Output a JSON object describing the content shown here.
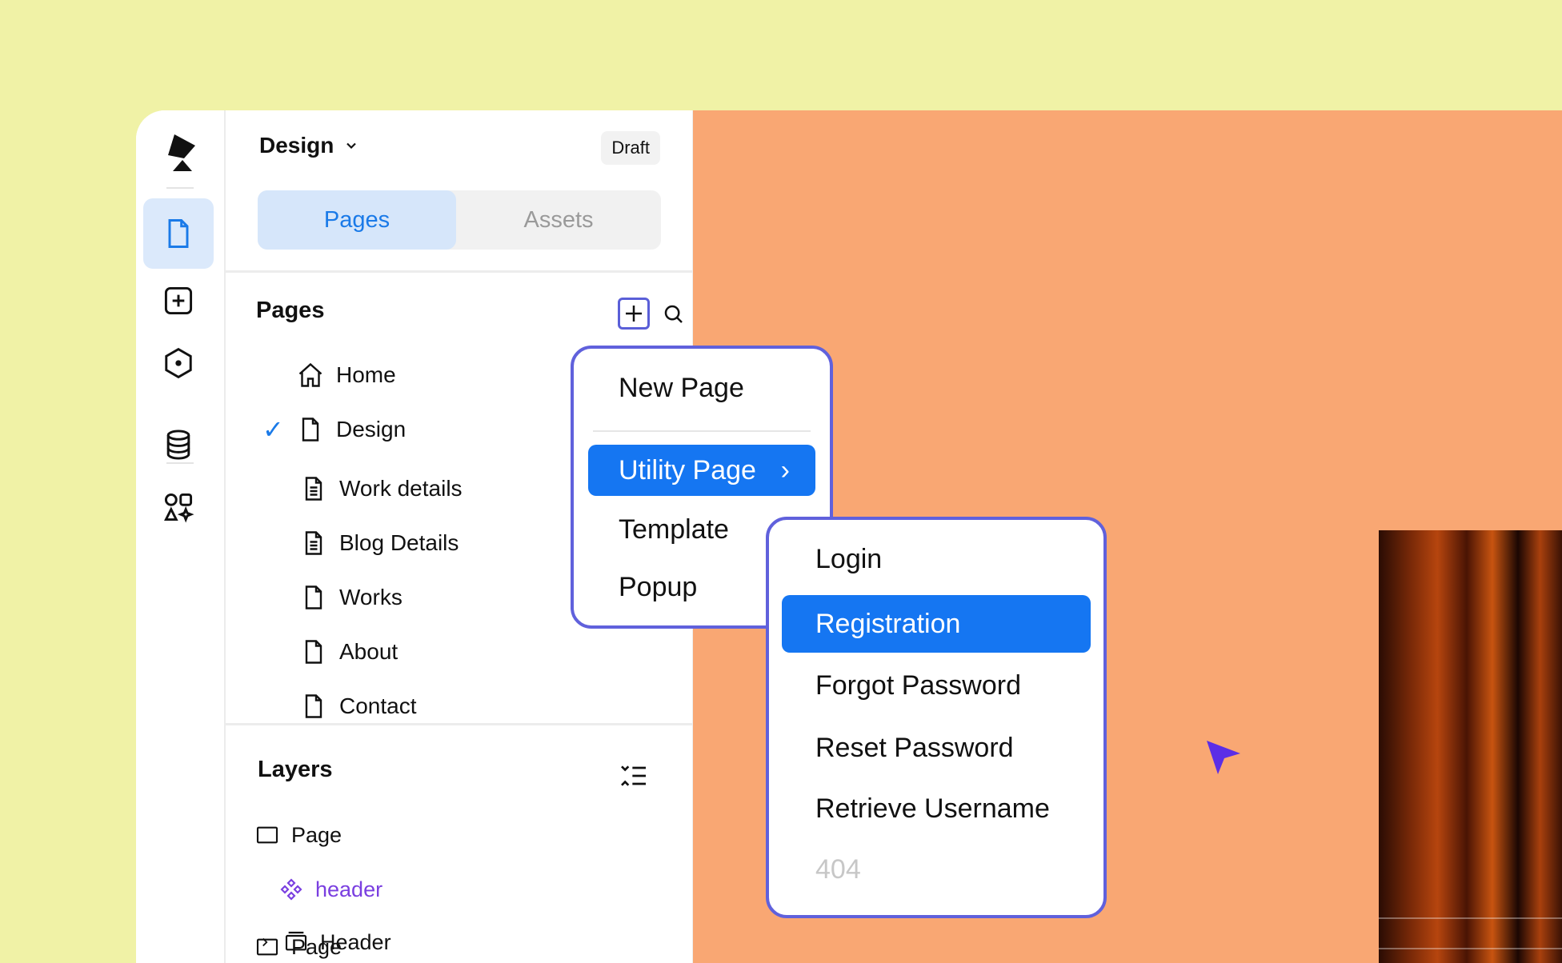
{
  "rail": {
    "icons": [
      "logo-icon",
      "page-icon",
      "add-icon",
      "component-icon",
      "database-icon",
      "apps-icon"
    ]
  },
  "panel": {
    "title": "Design",
    "status": "Draft",
    "tabs": [
      {
        "label": "Pages",
        "active": true
      },
      {
        "label": "Assets",
        "active": false
      }
    ]
  },
  "pages_section": {
    "title": "Pages",
    "items": [
      {
        "label": "Home",
        "icon": "home-icon",
        "checked": false
      },
      {
        "label": "Design",
        "icon": "page-icon",
        "checked": true
      },
      {
        "label": "Work details",
        "icon": "document-icon",
        "checked": false
      },
      {
        "label": "Blog Details",
        "icon": "document-icon",
        "checked": false
      },
      {
        "label": "Works",
        "icon": "page-icon",
        "checked": false
      },
      {
        "label": "About",
        "icon": "page-icon",
        "checked": false
      },
      {
        "label": "Contact",
        "icon": "page-icon",
        "checked": false
      }
    ],
    "check_glyph": "✓"
  },
  "layers_section": {
    "title": "Layers",
    "items": [
      {
        "label": "Page",
        "icon": "frame-icon"
      },
      {
        "label": "header",
        "icon": "component-icon",
        "color": "#7a3fe0"
      },
      {
        "label": "Header",
        "icon": "section-icon"
      }
    ]
  },
  "add_menu": {
    "items": [
      {
        "label": "New Page"
      },
      {
        "label": "Utility Page",
        "selected": true,
        "chevron": "›"
      },
      {
        "label": "Template"
      },
      {
        "label": "Popup"
      }
    ]
  },
  "utility_submenu": {
    "items": [
      {
        "label": "Login"
      },
      {
        "label": "Registration",
        "selected": true
      },
      {
        "label": "Forgot Password"
      },
      {
        "label": "Reset Password"
      },
      {
        "label": "Retrieve Username"
      },
      {
        "label": "404",
        "disabled": true
      }
    ]
  },
  "colors": {
    "background": "#f0f2a6",
    "canvas": "#f9a773",
    "accent": "#1576f2",
    "menu_border": "#6061dc",
    "active_tab_bg": "#d6e6fa"
  }
}
